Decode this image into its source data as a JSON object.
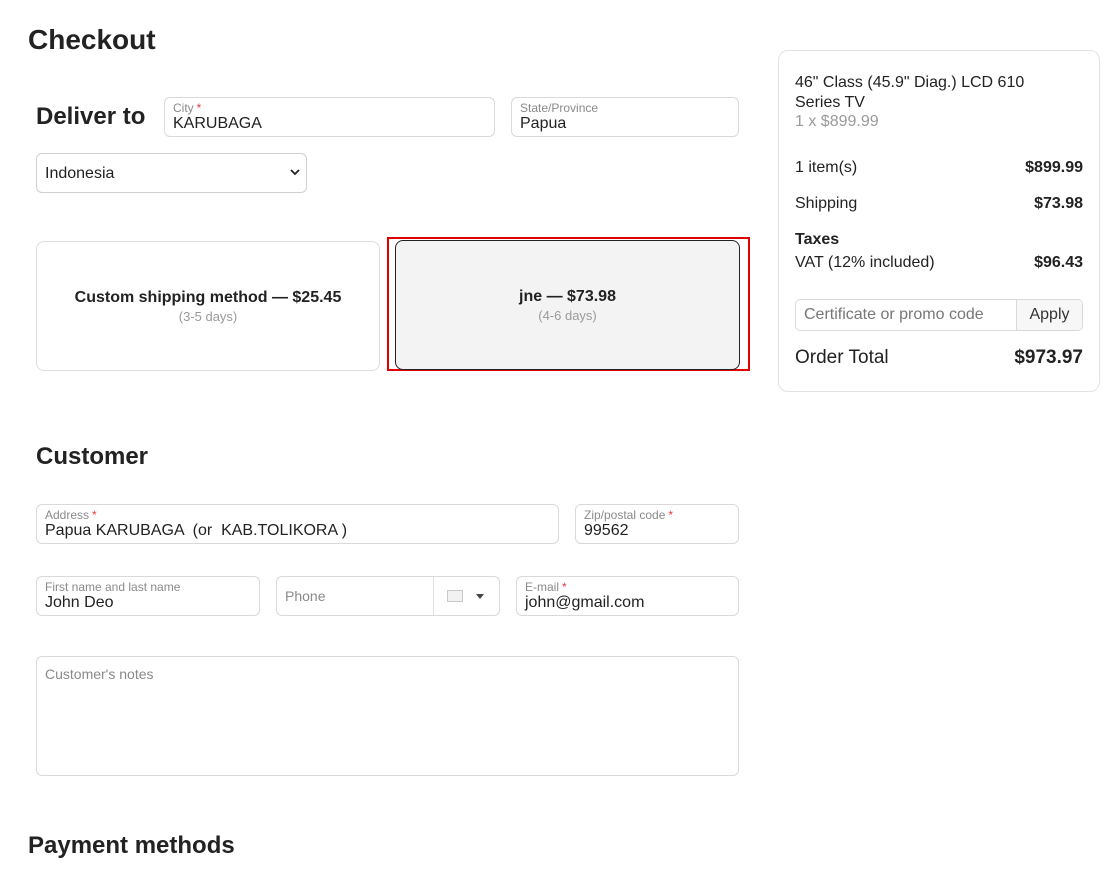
{
  "page_title": "Checkout",
  "deliver": {
    "heading": "Deliver to",
    "city": {
      "label": "City",
      "required_mark": "*",
      "value": "KARUBAGA"
    },
    "state": {
      "label": "State/Province",
      "value": "Papua"
    },
    "country": {
      "selected": "Indonesia"
    }
  },
  "shipping_methods": [
    {
      "title": "Custom shipping method — $25.45",
      "subtitle": "(3-5 days)",
      "selected": false
    },
    {
      "title": "jne — $73.98",
      "subtitle": "(4-6 days)",
      "selected": true
    }
  ],
  "customer": {
    "heading": "Customer",
    "address": {
      "label": "Address",
      "required_mark": "*",
      "value": "Papua KARUBAGA  (or  KAB.TOLIKORA )"
    },
    "zip": {
      "label": "Zip/postal code",
      "required_mark": "*",
      "value": "99562"
    },
    "name": {
      "label": "First name and last name",
      "value": "John Deo"
    },
    "phone": {
      "placeholder": "Phone"
    },
    "email": {
      "label": "E-mail",
      "required_mark": "*",
      "value": "john@gmail.com"
    },
    "notes": {
      "placeholder": "Customer's notes"
    }
  },
  "payment": {
    "heading": "Payment methods"
  },
  "summary": {
    "product_name": "46\" Class (45.9\" Diag.) LCD 610 Series TV",
    "product_qty_price": "1 x $899.99",
    "items_label": "1 item(s)",
    "items_value": "$899.99",
    "shipping_label": "Shipping",
    "shipping_value": "$73.98",
    "taxes_heading": "Taxes",
    "vat_label": "VAT (12% included)",
    "vat_value": "$96.43",
    "promo_placeholder": "Certificate or promo code",
    "apply_label": "Apply",
    "total_label": "Order Total",
    "total_value": "$973.97"
  },
  "colors": {
    "highlight": "#e00000",
    "required": "#e23b3b"
  },
  "icons": [
    "chevron-down-icon",
    "flag-icon",
    "caret-down-icon"
  ]
}
